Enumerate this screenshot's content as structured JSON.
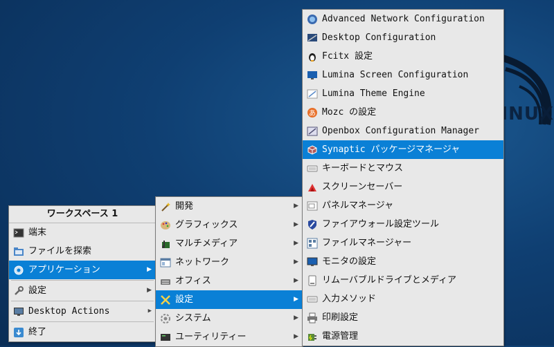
{
  "wallpaper": {
    "brand_text": "LINUX"
  },
  "main_menu": {
    "title": "ワークスペース 1",
    "items": [
      {
        "label": "端末",
        "icon": "terminal-icon"
      },
      {
        "label": "ファイルを探索",
        "icon": "folder-icon"
      },
      {
        "label": "アプリケーション",
        "icon": "gear-icon",
        "highlighted": true
      },
      {
        "label": "設定",
        "icon": "wrench-icon"
      },
      {
        "label": "Desktop Actions",
        "icon": "monitor-icon"
      },
      {
        "label": "終了",
        "icon": "exit-icon"
      }
    ]
  },
  "apps_menu": {
    "items": [
      {
        "label": "開発",
        "icon": "wand-icon"
      },
      {
        "label": "グラフィックス",
        "icon": "palette-icon"
      },
      {
        "label": "マルチメディア",
        "icon": "media-icon"
      },
      {
        "label": "ネットワーク",
        "icon": "network-icon"
      },
      {
        "label": "オフィス",
        "icon": "office-icon"
      },
      {
        "label": "設定",
        "icon": "tools-icon",
        "highlighted": true
      },
      {
        "label": "システム",
        "icon": "system-icon"
      },
      {
        "label": "ユーティリティー",
        "icon": "utility-icon"
      }
    ]
  },
  "settings_menu": {
    "items": [
      {
        "label": "Advanced Network Configuration",
        "icon": "network-config-icon"
      },
      {
        "label": "Desktop Configuration",
        "icon": "desktop-config-icon"
      },
      {
        "label": "Fcitx 設定",
        "icon": "penguin-icon"
      },
      {
        "label": "Lumina Screen Configuration",
        "icon": "screen-icon"
      },
      {
        "label": "Lumina Theme Engine",
        "icon": "theme-icon"
      },
      {
        "label": "Mozc の設定",
        "icon": "mozc-icon"
      },
      {
        "label": "Openbox Configuration Manager",
        "icon": "openbox-icon"
      },
      {
        "label": "Synaptic パッケージマネージャ",
        "icon": "package-icon",
        "highlighted": true
      },
      {
        "label": "キーボードとマウス",
        "icon": "keyboard-icon"
      },
      {
        "label": "スクリーンセーバー",
        "icon": "screensaver-icon"
      },
      {
        "label": "パネルマネージャ",
        "icon": "panel-icon"
      },
      {
        "label": "ファイアウォール設定ツール",
        "icon": "shield-icon"
      },
      {
        "label": "ファイルマネージャー",
        "icon": "file-manager-icon"
      },
      {
        "label": "モニタの設定",
        "icon": "monitor-icon"
      },
      {
        "label": "リムーバブルドライブとメディア",
        "icon": "removable-icon"
      },
      {
        "label": "入力メソッド",
        "icon": "keyboard-icon"
      },
      {
        "label": "印刷設定",
        "icon": "printer-icon"
      },
      {
        "label": "電源管理",
        "icon": "power-icon"
      }
    ]
  },
  "colors": {
    "highlight": "#0a80d6",
    "menu_bg": "#e8e8e8",
    "desktop": "#0f3f72"
  }
}
